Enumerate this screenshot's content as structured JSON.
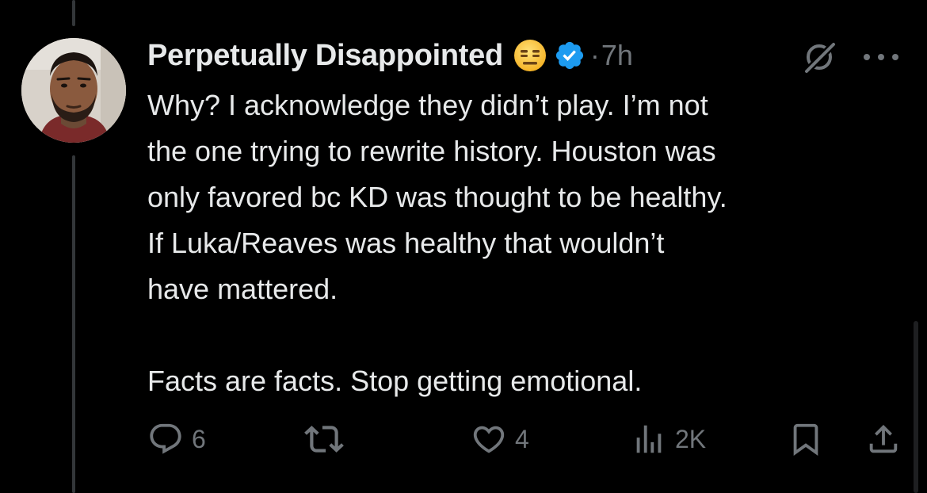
{
  "post": {
    "author": {
      "display_name": "Perpetually Disappointed",
      "status_emoji": "expressionless-face-emoji",
      "verified_icon": "verified-badge-icon"
    },
    "separator": "·",
    "time": "7h",
    "body_lines": [
      "Why? I acknowledge they didn’t play. I’m not\nthe one trying to rewrite history. Houston was\nonly favored bc KD was thought to be healthy.\nIf Luka/Reaves was healthy that wouldn’t\nhave mattered.",
      "Facts are facts. Stop getting emotional."
    ],
    "actions": {
      "replies": "6",
      "reposts": "",
      "likes": "4",
      "views": "2K"
    }
  },
  "colors": {
    "background": "#000000",
    "text": "#e7e9ea",
    "muted": "#71767b",
    "verified": "#1d9bf0",
    "thread_line": "#333639"
  }
}
